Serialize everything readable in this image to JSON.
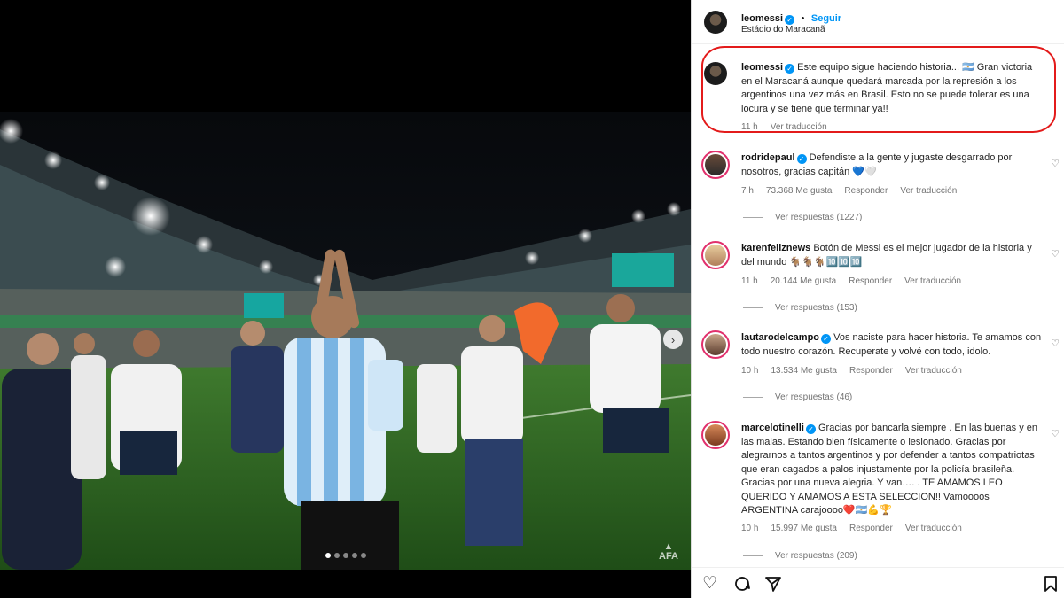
{
  "post": {
    "photo_dots": 5,
    "active_dot": 0,
    "next_icon": "chevron-right-icon",
    "afa_watermark": "AFA"
  },
  "header": {
    "username": "leomessi",
    "separator": "•",
    "follow_label": "Seguir",
    "location": "Estádio do Maracanã"
  },
  "caption": {
    "username": "leomessi",
    "text": "Este equipo sigue haciendo historia... 🇦🇷 Gran victoria en el Maracaná aunque quedará marcada por la represión a los argentinos una vez más en Brasil. Esto no se puede tolerar es una locura y se tiene que terminar ya!!",
    "time": "11 h",
    "translate": "Ver traducción"
  },
  "comments": [
    {
      "username": "rodridepaul",
      "verified": true,
      "text": "Defendiste a la gente y jugaste desgarrado por nosotros, gracias capitán 💙🤍",
      "time": "7 h",
      "likes": "73.368 Me gusta",
      "reply": "Responder",
      "translate": "Ver traducción",
      "replies": "Ver respuestas (1227)"
    },
    {
      "username": "karenfeliznews",
      "verified": false,
      "text": "Botón de Messi es el mejor jugador de la historia y del mundo 🐐🐐🐐🔟🔟🔟",
      "time": "11 h",
      "likes": "20.144 Me gusta",
      "reply": "Responder",
      "translate": "Ver traducción",
      "replies": "Ver respuestas (153)"
    },
    {
      "username": "lautarodelcampo",
      "verified": true,
      "text": "Vos naciste para hacer historia. Te amamos con todo nuestro corazón. Recuperate y volvé con todo, idolo.",
      "time": "10 h",
      "likes": "13.534 Me gusta",
      "reply": "Responder",
      "translate": "Ver traducción",
      "replies": "Ver respuestas (46)"
    },
    {
      "username": "marcelotinelli",
      "verified": true,
      "text": "Gracias por bancarla siempre . En las buenas y en las malas. Estando bien físicamente o lesionado. Gracias por alegrarnos a tantos argentinos y por defender a tantos compatriotas que eran cagados a palos injustamente por la policía brasileña. Gracias por una nueva alegria. Y van…. . TE AMAMOS LEO QUERIDO Y AMAMOS A ESTA SELECCION!! Vamoooos ARGENTINA carajoooo❤️🇦🇷💪🏆",
      "time": "10 h",
      "likes": "15.997 Me gusta",
      "reply": "Responder",
      "translate": "Ver traducción",
      "replies": "Ver respuestas (209)"
    }
  ],
  "actions": {
    "like_icon": "heart-icon",
    "comment_icon": "comment-icon",
    "share_icon": "send-icon",
    "save_icon": "bookmark-icon"
  },
  "colors": {
    "accent": "#0095f6",
    "highlight": "#e31b1b"
  }
}
